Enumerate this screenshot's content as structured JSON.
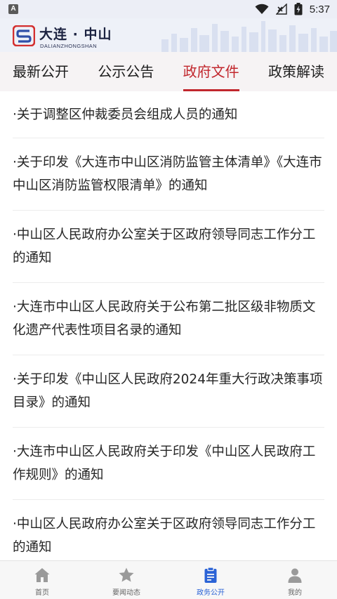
{
  "status_bar": {
    "notification_icon": "a-app-icon",
    "icons": [
      "wifi-icon",
      "no-signal-icon",
      "battery-charging-icon"
    ],
    "time": "5:37"
  },
  "header": {
    "title": "大连 · 中山",
    "subtitle": "DALIANZHONGSHAN",
    "logo": "dalian-zhongshan-logo",
    "colors": {
      "logo_red": "#d32f2f",
      "logo_blue": "#2f4fa8"
    }
  },
  "tabs": [
    {
      "label": "最新公开",
      "active": false
    },
    {
      "label": "公示公告",
      "active": false
    },
    {
      "label": "政府文件",
      "active": true
    },
    {
      "label": "政策解读",
      "active": false
    }
  ],
  "accent_color": "#c1272d",
  "documents": [
    {
      "title": "·关于调整区仲裁委员会组成人员的通知"
    },
    {
      "title": "·关于印发《大连市中山区消防监管主体清单》《大连市中山区消防监管权限清单》的通知"
    },
    {
      "title": "·中山区人民政府办公室关于区政府领导同志工作分工的通知"
    },
    {
      "title": "·大连市中山区人民政府关于公布第二批区级非物质文化遗产代表性项目名录的通知"
    },
    {
      "title": "·关于印发《中山区人民政府2024年重大行政决策事项目录》的通知"
    },
    {
      "title": "·大连市中山区人民政府关于印发《中山区人民政府工作规则》的通知"
    },
    {
      "title": "·中山区人民政府办公室关于区政府领导同志工作分工的通知"
    }
  ],
  "bottom_nav": [
    {
      "label": "首页",
      "icon": "home-icon",
      "active": false
    },
    {
      "label": "要闻动态",
      "icon": "star-icon",
      "active": false
    },
    {
      "label": "政务公开",
      "icon": "clipboard-icon",
      "active": true
    },
    {
      "label": "我的",
      "icon": "person-icon",
      "active": false
    }
  ]
}
